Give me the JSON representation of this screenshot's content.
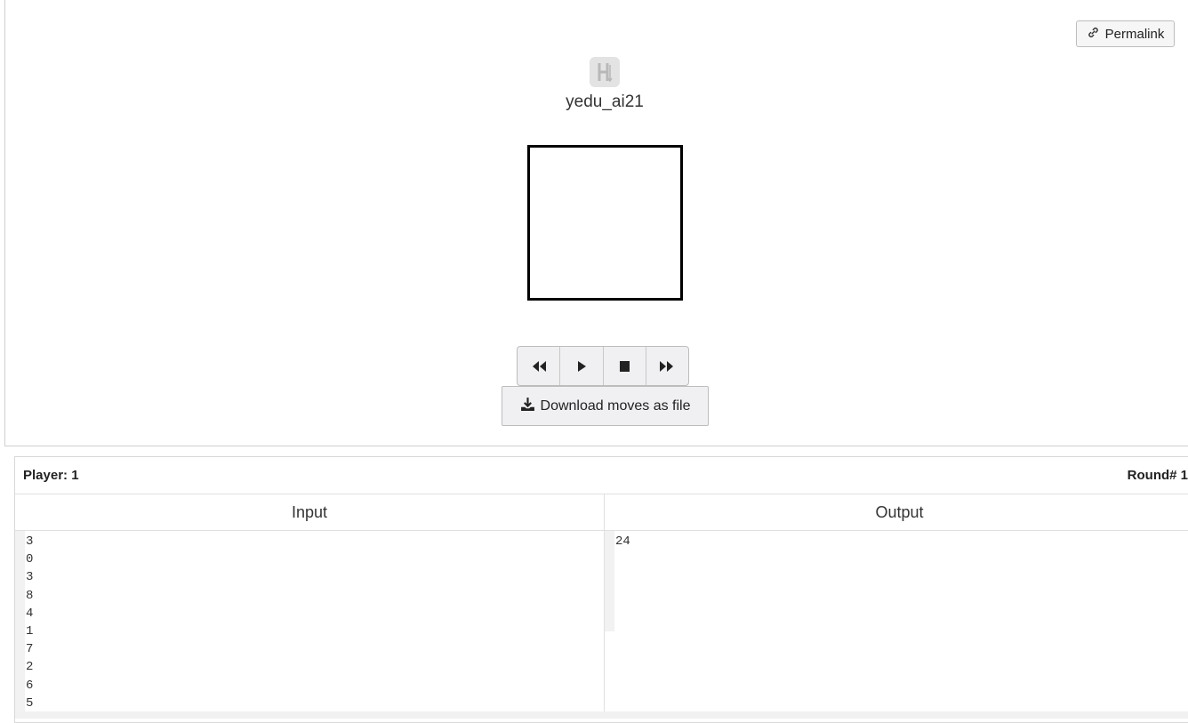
{
  "toolbar": {
    "permalink_label": "Permalink"
  },
  "player": {
    "name": "yedu_ai21",
    "icon": "h-arrow-icon"
  },
  "playback": {
    "buttons": [
      "rewind-icon",
      "play-icon",
      "stop-icon",
      "fast-forward-icon"
    ],
    "download_label": "Download moves as file"
  },
  "status": {
    "player_label": "Player: 1",
    "round_label": "Round# 1"
  },
  "io": {
    "input_header": "Input",
    "output_header": "Output",
    "input_lines": [
      "3",
      "0",
      "3",
      "8",
      "4",
      "1",
      "7",
      "2",
      "6",
      "5"
    ],
    "output_lines": [
      "24"
    ]
  },
  "colors": {
    "panel_border": "#cfcfcf",
    "button_bg": "#f0f0f3",
    "board_border": "#000000"
  }
}
